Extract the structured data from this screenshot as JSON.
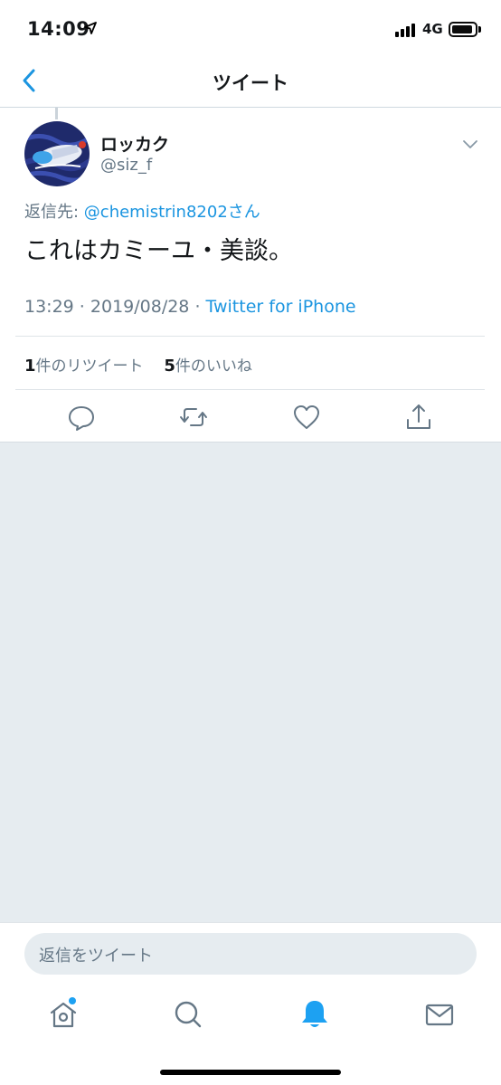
{
  "status_bar": {
    "time": "14:09",
    "network": "4G"
  },
  "nav": {
    "title": "ツイート"
  },
  "tweet": {
    "display_name": "ロッカク",
    "handle": "@siz_f",
    "reply_prefix": "返信先: ",
    "reply_mention": "@chemistrin8202さん",
    "text": "これはカミーユ・美談。",
    "time": "13:29",
    "date": "2019/08/28",
    "separator": " · ",
    "source": "Twitter for iPhone",
    "retweet_count": "1",
    "retweet_label": "件のリツイート",
    "like_count": "5",
    "like_label": "件のいいね"
  },
  "composer": {
    "placeholder": "返信をツイート"
  },
  "colors": {
    "accent": "#1b95e0",
    "muted": "#657786",
    "background_gray": "#e6ecf0"
  },
  "icons": {
    "actions": [
      "reply-icon",
      "retweet-icon",
      "like-icon",
      "share-icon"
    ],
    "tabs": [
      "home-icon",
      "search-icon",
      "notifications-icon",
      "messages-icon"
    ]
  }
}
